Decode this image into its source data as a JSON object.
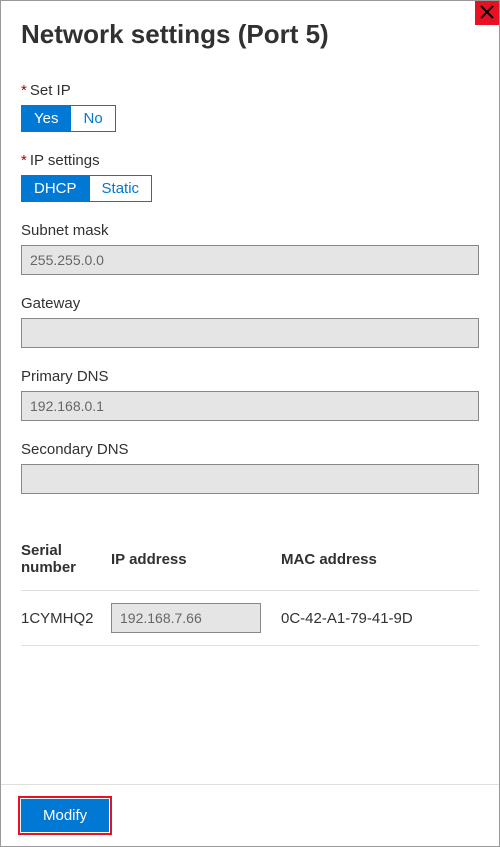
{
  "title": "Network settings (Port 5)",
  "setIp": {
    "label": "Set IP",
    "options": {
      "yes": "Yes",
      "no": "No"
    },
    "selected": "yes"
  },
  "ipSettings": {
    "label": "IP settings",
    "options": {
      "dhcp": "DHCP",
      "static": "Static"
    },
    "selected": "dhcp"
  },
  "subnetMask": {
    "label": "Subnet mask",
    "value": "255.255.0.0"
  },
  "gateway": {
    "label": "Gateway",
    "value": ""
  },
  "primaryDns": {
    "label": "Primary DNS",
    "value": "192.168.0.1"
  },
  "secondaryDns": {
    "label": "Secondary DNS",
    "value": ""
  },
  "table": {
    "headers": {
      "serial": "Serial number",
      "ip": "IP address",
      "mac": "MAC address"
    },
    "row": {
      "serial": "1CYMHQ2",
      "ip": "192.168.7.66",
      "mac": "0C-42-A1-79-41-9D"
    }
  },
  "footer": {
    "modify": "Modify"
  }
}
